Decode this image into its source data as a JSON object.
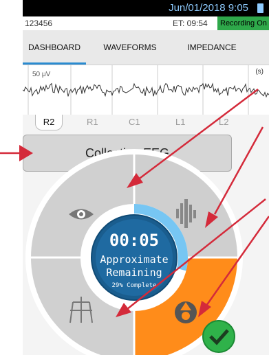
{
  "status": {
    "datetime": "Jun/01/2018 9:05"
  },
  "info": {
    "patient_id": "123456",
    "elapsed": "ET: 09:54",
    "recording": "Recording On"
  },
  "tabs": [
    {
      "label": "DASHBOARD",
      "active": true
    },
    {
      "label": "WAVEFORMS"
    },
    {
      "label": "IMPEDANCE"
    }
  ],
  "waveform": {
    "scale": "50 μV",
    "time_unit": "(s)"
  },
  "channels": [
    {
      "label": "R2",
      "active": true
    },
    {
      "label": "R1"
    },
    {
      "label": "C1"
    },
    {
      "label": "L1"
    },
    {
      "label": "L2"
    }
  ],
  "banner": {
    "text": "Collecting EEG"
  },
  "timer": {
    "time": "00:05",
    "line1": "Approximate",
    "line2": "Remaining",
    "progress_text": "29% Complete",
    "progress": 0.29
  },
  "wheel": {
    "segments": [
      "eye-icon",
      "artifact-icon",
      "device-icon",
      "tower-icon"
    ]
  },
  "colors": {
    "accent": "#2a8bd0",
    "orange": "#ff8c1a",
    "progress": "#77c6f3",
    "arrows": "#d42a3a",
    "ok": "#2fb24a"
  }
}
